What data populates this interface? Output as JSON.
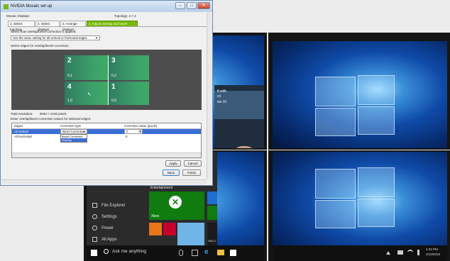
{
  "dialog": {
    "title": "NVIDIA Mosaic set up",
    "min_glyph": "–",
    "max_glyph": "□",
    "close_glyph": "✕",
    "mode_label": "Mosaic Displays",
    "topology_label": "Topology: 2 × 2",
    "tabs": [
      {
        "label": "1. Select topology"
      },
      {
        "label": "2. Select displays"
      },
      {
        "label": "3. Arrange displays"
      },
      {
        "label": "4. Adjust overlap and bezel correction"
      }
    ],
    "apply_prompt": "Select how overlap/bezel correction is applied:",
    "apply_mode": "Use the same setting for all vertical or horizontal edges",
    "edges_prompt": "Select edges for overlap/bezel correction",
    "displays": [
      {
        "number": "2",
        "coords": "0,1"
      },
      {
        "number": "3",
        "coords": "0,2"
      },
      {
        "number": "4",
        "coords": "1,0"
      },
      {
        "number": "1",
        "coords": "0,0"
      }
    ],
    "total_resolution_label": "Total resolution:",
    "total_resolution_value": "3840 × 2160 pixels",
    "values_prompt": "Enter overlap/bezel correction values for selected edges:",
    "grid_headers": {
      "edges": "Edges",
      "type": "Correction type",
      "value": "Correction value (pixels)"
    },
    "rows": [
      {
        "edge": "All vertical",
        "type": "Bezel Correction",
        "value": "0"
      },
      {
        "edge": "All horizontal",
        "type": "",
        "value": "0"
      }
    ],
    "dropdown_options": [
      "Bezel Correction",
      "Overlap"
    ],
    "buttons": {
      "apply": "Apply",
      "cancel": "Cancel",
      "back": "Back",
      "finish": "Finish"
    }
  },
  "start_menu": {
    "group_label": "Entertainment",
    "items": [
      "File Explorer",
      "Settings",
      "Power",
      "All Apps"
    ],
    "tiles": {
      "xbox": "Xbox",
      "halo": "HALO"
    }
  },
  "taskbar": {
    "search_placeholder": "Ask me anything",
    "clock_time": "4:32 PM",
    "clock_date": "2/10/2016"
  },
  "news_tile": {
    "line1": "ft with",
    "line2": "cri",
    "line3": "ws 10"
  },
  "colors": {
    "nvidia_green": "#76b900",
    "win_blue": "#0f4aa8",
    "xbox_green": "#107c10"
  }
}
